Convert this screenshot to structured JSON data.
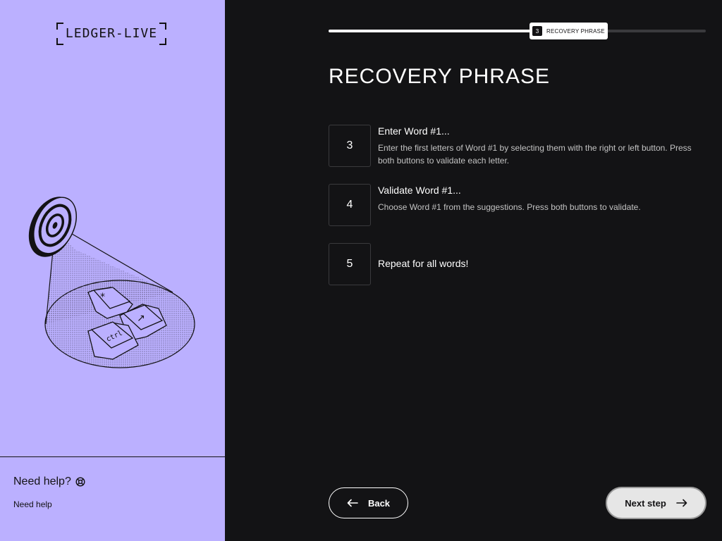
{
  "brand": {
    "logo_text": "LEDGER-LIVE"
  },
  "sidebar": {
    "help_title": "Need help?",
    "help_link": "Need help"
  },
  "progress": {
    "fraction": 0.55,
    "step_number": "3",
    "step_label": "RECOVERY PHRASE"
  },
  "main": {
    "title": "RECOVERY PHRASE",
    "steps": [
      {
        "number": "3",
        "title": "Enter Word #1...",
        "description": "Enter the first letters of Word #1 by selecting them with the right or left button. Press both buttons to validate each letter."
      },
      {
        "number": "4",
        "title": "Validate Word #1...",
        "description": "Choose Word #1 from the suggestions. Press both buttons to validate."
      },
      {
        "number": "5",
        "title": "Repeat for all words!",
        "description": ""
      }
    ]
  },
  "footer": {
    "back_label": "Back",
    "next_label": "Next step"
  },
  "illustration": {
    "key_labels": [
      "*",
      "↗",
      "ctrl"
    ]
  },
  "colors": {
    "left_bg": "#BBB0FF",
    "main_bg": "#131315",
    "accent_white": "#FFFFFF"
  }
}
